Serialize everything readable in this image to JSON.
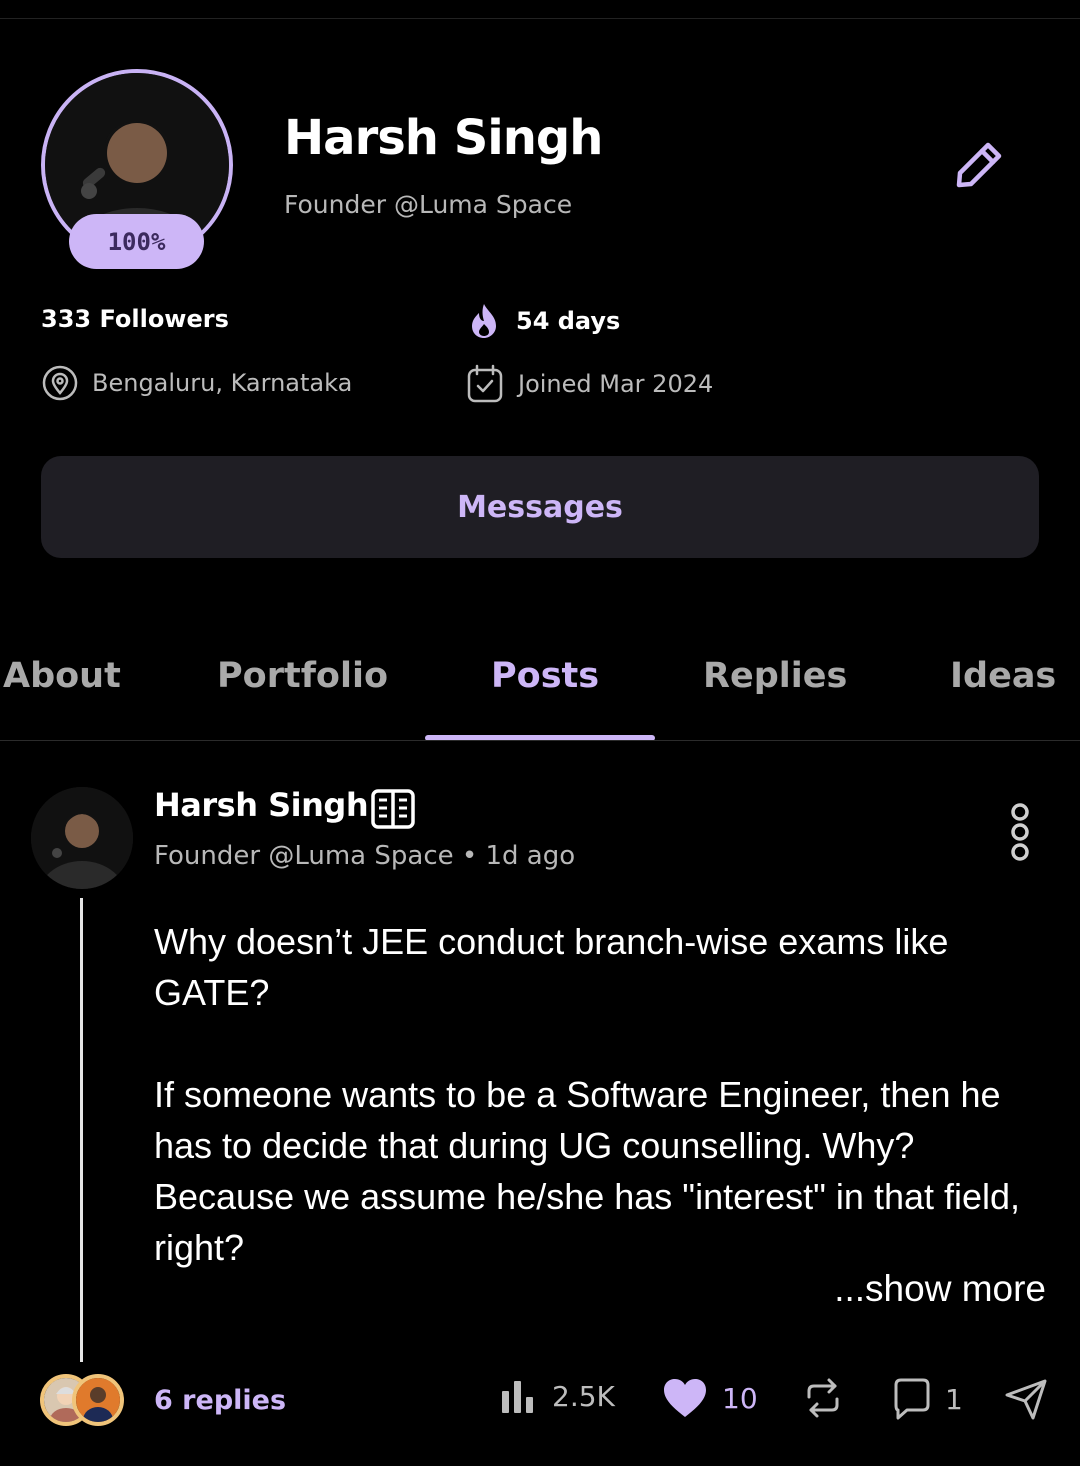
{
  "profile": {
    "name": "Harsh Singh",
    "role": "Founder @Luma Space",
    "completion": "100%",
    "followers": "333 Followers",
    "streak": "54 days",
    "location": "Bengaluru, Karnataka",
    "joined": "Joined Mar 2024",
    "messages_label": "Messages"
  },
  "tabs": [
    {
      "label": "About",
      "active": false
    },
    {
      "label": "Portfolio",
      "active": false
    },
    {
      "label": "Posts",
      "active": true
    },
    {
      "label": "Replies",
      "active": false
    },
    {
      "label": "Ideas",
      "active": false
    }
  ],
  "post": {
    "author": "Harsh Singh",
    "author_role": "Founder @Luma Space",
    "separator": "•",
    "time": "1d ago",
    "paragraphs": [
      "Why doesn’t JEE conduct branch-wise exams like GATE?",
      "If someone wants to be a Software Engineer, then he has to decide that during UG counselling. Why? Because we assume he/she has \"interest\" in that field, right?"
    ],
    "show_more": "...show more",
    "replies": "6 replies",
    "views": "2.5K",
    "likes": "10",
    "comments": "1"
  },
  "colors": {
    "accent": "#cdb6f7",
    "background": "#000000",
    "button_bg": "#1f1e24",
    "muted_text": "#b8b8b8",
    "reply_avatar_ring": "#f0c47a"
  },
  "icons": [
    "pencil-icon",
    "flame-icon",
    "location-pin-icon",
    "calendar-check-icon",
    "book-open-icon",
    "more-vertical-icon",
    "bar-chart-icon",
    "heart-icon",
    "repost-icon",
    "comment-icon",
    "send-icon"
  ]
}
